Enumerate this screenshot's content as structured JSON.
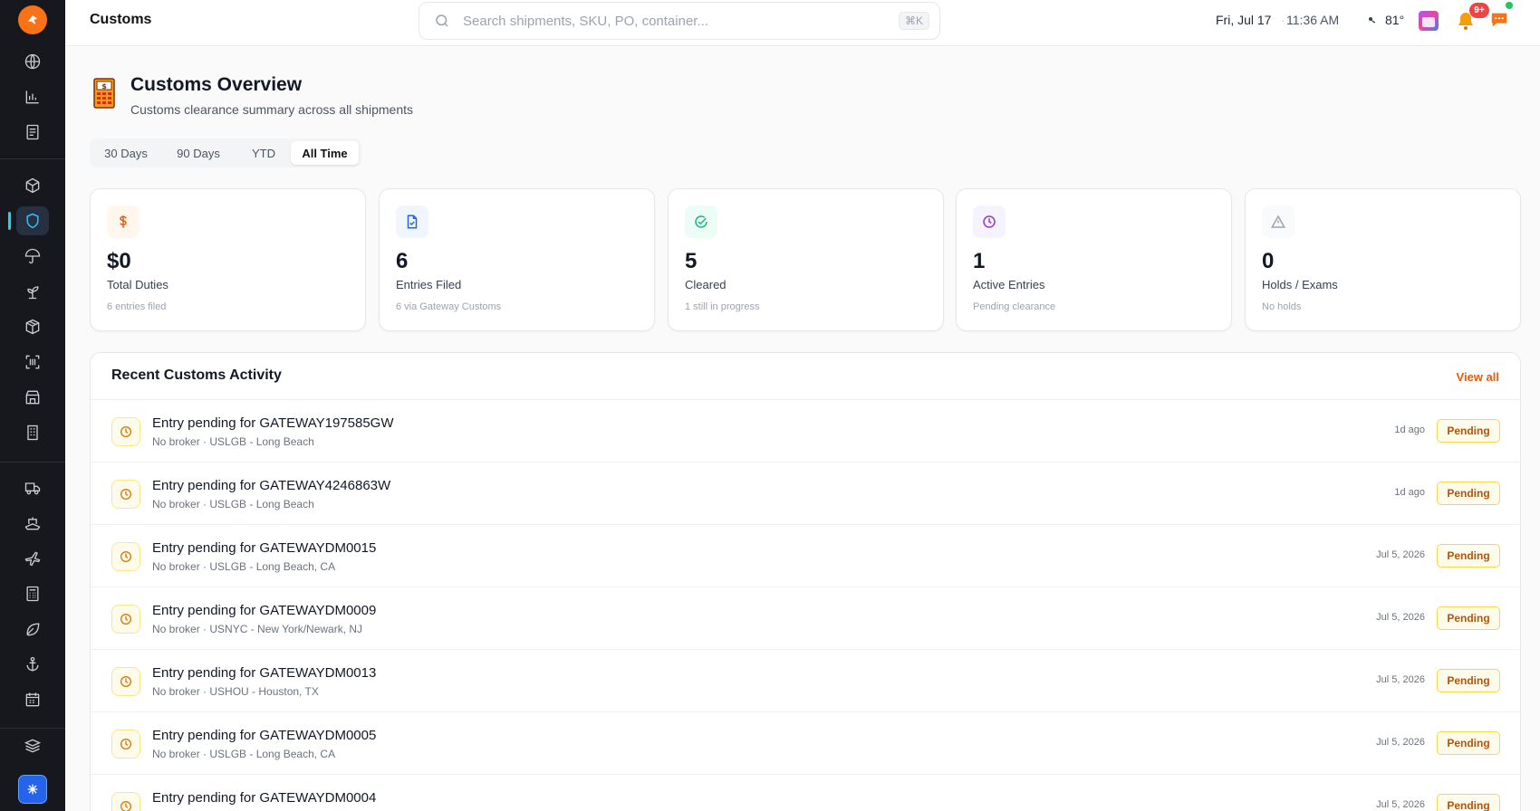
{
  "topbar": {
    "page": "Customs",
    "search_placeholder": "Search shipments, SKU, PO, container...",
    "shortcut": "⌘K",
    "date": "Fri, Jul 17",
    "separator": "·",
    "time": "11:36 AM",
    "temperature": "81°",
    "notification_count": "9+"
  },
  "header": {
    "title": "Customs Overview",
    "subtitle": "Customs clearance summary across all shipments"
  },
  "tabs": [
    {
      "label": "30 Days",
      "active": false
    },
    {
      "label": "90 Days",
      "active": false
    },
    {
      "label": "YTD",
      "active": false
    },
    {
      "label": "All Time",
      "active": true
    }
  ],
  "stats": [
    {
      "value": "$0",
      "label": "Total Duties",
      "sub": "6 entries filed",
      "icon": "dollar-icon",
      "color": "#ea580c",
      "bg": "#fff7ed"
    },
    {
      "value": "6",
      "label": "Entries Filed",
      "sub": "6 via Gateway Customs",
      "icon": "document-check-icon",
      "color": "#2563eb",
      "bg": "#eff6ff"
    },
    {
      "value": "5",
      "label": "Cleared",
      "sub": "1 still in progress",
      "icon": "check-circle-icon",
      "color": "#10b981",
      "bg": "#ecfdf5"
    },
    {
      "value": "1",
      "label": "Active Entries",
      "sub": "Pending clearance",
      "icon": "clock-icon",
      "color": "#9333ea",
      "bg": "#f5f3ff"
    },
    {
      "value": "0",
      "label": "Holds / Exams",
      "sub": "No holds",
      "icon": "warning-icon",
      "color": "#9ca3af",
      "bg": "#f9fafb"
    }
  ],
  "activity": {
    "title": "Recent Customs Activity",
    "view_all": "View all",
    "rows": [
      {
        "title": "Entry pending for GATEWAY197585GW",
        "sub": "No broker · USLGB - Long Beach",
        "time": "1d ago",
        "status": "Pending"
      },
      {
        "title": "Entry pending for GATEWAY4246863W",
        "sub": "No broker · USLGB - Long Beach",
        "time": "1d ago",
        "status": "Pending"
      },
      {
        "title": "Entry pending for GATEWAYDM0015",
        "sub": "No broker · USLGB - Long Beach, CA",
        "time": "Jul 5, 2026",
        "status": "Pending"
      },
      {
        "title": "Entry pending for GATEWAYDM0009",
        "sub": "No broker · USNYC - New York/Newark, NJ",
        "time": "Jul 5, 2026",
        "status": "Pending"
      },
      {
        "title": "Entry pending for GATEWAYDM0013",
        "sub": "No broker · USHOU - Houston, TX",
        "time": "Jul 5, 2026",
        "status": "Pending"
      },
      {
        "title": "Entry pending for GATEWAYDM0005",
        "sub": "No broker · USLGB - Long Beach, CA",
        "time": "Jul 5, 2026",
        "status": "Pending"
      },
      {
        "title": "Entry pending for GATEWAYDM0004",
        "sub": "",
        "time": "Jul 5, 2026",
        "status": "Pending"
      }
    ]
  },
  "sidebar": {
    "icons": [
      "globe-icon",
      "bar-chart-icon",
      "document-icon",
      "cube-icon",
      "shield-icon",
      "umbrella-icon",
      "sprout-icon",
      "package-icon",
      "scan-icon",
      "store-icon",
      "building-icon",
      "truck-icon",
      "ship-icon",
      "plane-icon",
      "calculator-icon",
      "leaf-icon",
      "anchor-icon",
      "calendar-icon",
      "layers-icon"
    ],
    "active": "shield-icon"
  }
}
